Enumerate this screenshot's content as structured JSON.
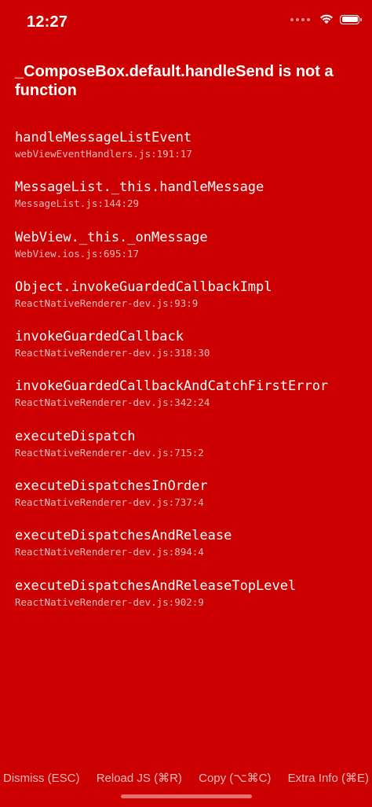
{
  "status_bar": {
    "time": "12:27",
    "icons": [
      "cellular-dots-icon",
      "wifi-icon",
      "battery-icon"
    ]
  },
  "error": {
    "message": "_ComposeBox.default.handleSend is not a function"
  },
  "stack": [
    {
      "method": "handleMessageListEvent",
      "location": "webViewEventHandlers.js:191:17"
    },
    {
      "method": "MessageList._this.handleMessage",
      "location": "MessageList.js:144:29"
    },
    {
      "method": "WebView._this._onMessage",
      "location": "WebView.ios.js:695:17"
    },
    {
      "method": "Object.invokeGuardedCallbackImpl",
      "location": "ReactNativeRenderer-dev.js:93:9"
    },
    {
      "method": "invokeGuardedCallback",
      "location": "ReactNativeRenderer-dev.js:318:30"
    },
    {
      "method": "invokeGuardedCallbackAndCatchFirstError",
      "location": "ReactNativeRenderer-dev.js:342:24"
    },
    {
      "method": "executeDispatch",
      "location": "ReactNativeRenderer-dev.js:715:2"
    },
    {
      "method": "executeDispatchesInOrder",
      "location": "ReactNativeRenderer-dev.js:737:4"
    },
    {
      "method": "executeDispatchesAndRelease",
      "location": "ReactNativeRenderer-dev.js:894:4"
    },
    {
      "method": "executeDispatchesAndReleaseTopLevel",
      "location": "ReactNativeRenderer-dev.js:902:9"
    }
  ],
  "toolbar": {
    "dismiss_label": "Dismiss (ESC)",
    "reload_label": "Reload JS (⌘R)",
    "copy_label": "Copy (⌥⌘C)",
    "extra_info_label": "Extra Info (⌘E)"
  },
  "colors": {
    "background": "#cc0000",
    "text": "#ffffff",
    "secondary_text": "rgba(255,255,255,0.72)"
  }
}
